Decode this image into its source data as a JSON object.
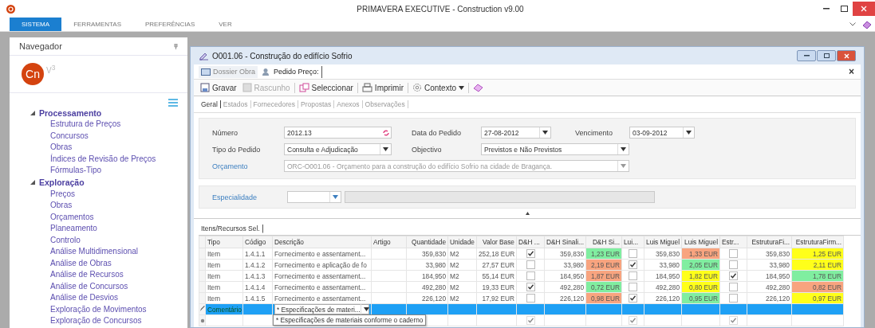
{
  "window": {
    "title": "PRIMAVERA EXECUTIVE - Construction v9.00"
  },
  "ribbon_tabs": [
    {
      "label": "SISTEMA",
      "selected": true
    },
    {
      "label": "FERRAMENTAS",
      "selected": false
    },
    {
      "label": "PREFERÊNCIAS",
      "selected": false
    },
    {
      "label": "VER",
      "selected": false
    }
  ],
  "navigator": {
    "title": "Navegador",
    "logo": "Cn",
    "version": "V$^{3}$",
    "tree": [
      {
        "label": "Processamento",
        "expanded": true,
        "children": [
          {
            "label": "Estrutura de Preços"
          },
          {
            "label": "Concursos"
          },
          {
            "label": "Obras"
          },
          {
            "label": "Índices de Revisão de Preços"
          },
          {
            "label": "Fórmulas-Tipo"
          }
        ]
      },
      {
        "label": "Exploração",
        "expanded": true,
        "children": [
          {
            "label": "Preços"
          },
          {
            "label": "Obras"
          },
          {
            "label": "Orçamentos"
          },
          {
            "label": "Planeamento"
          },
          {
            "label": "Controlo"
          },
          {
            "label": "Análise Multidimensional"
          },
          {
            "label": "Análise de Obras"
          },
          {
            "label": "Análise de Recursos"
          },
          {
            "label": "Análise de Concursos"
          },
          {
            "label": "Análise de Desvios"
          },
          {
            "label": "Exploração de Movimentos"
          },
          {
            "label": "Exploração de Concursos"
          }
        ]
      }
    ]
  },
  "document": {
    "title": "O001.06 - Construção do edifício Sofrio",
    "close": "×",
    "tabs": [
      {
        "label": "Dossier Obra",
        "selected": false
      },
      {
        "label": "Pedido Preço:",
        "selected": true
      }
    ],
    "toolbar": [
      {
        "kind": "save",
        "label": "Gravar",
        "disabled": false
      },
      {
        "kind": "draft",
        "label": "Rascunho",
        "disabled": true
      },
      {
        "kind": "select",
        "label": "Seleccionar",
        "disabled": false
      },
      {
        "kind": "print",
        "label": "Imprimir",
        "disabled": false
      },
      {
        "kind": "menu",
        "label": "Contexto",
        "disabled": false
      },
      {
        "kind": "eraser"
      }
    ],
    "subtabs": [
      {
        "label": "Geral",
        "selected": true
      },
      {
        "label": "Estados",
        "selected": false
      },
      {
        "label": "Fornecedores",
        "selected": false
      },
      {
        "label": "Propostas",
        "selected": false
      },
      {
        "label": "Anexos",
        "selected": false
      },
      {
        "label": "Observações",
        "selected": false
      }
    ],
    "form": {
      "numero": {
        "label": "Número",
        "value": "2012.13"
      },
      "data_pedido": {
        "label": "Data do Pedido",
        "value": "27-08-2012"
      },
      "vencimento": {
        "label": "Vencimento",
        "value": "03-09-2012"
      },
      "tipo_pedido": {
        "label": "Tipo do Pedido",
        "value": "Consulta e Adjudicação"
      },
      "objectivo": {
        "label": "Objectivo",
        "value": "Previstos e Não Previstos"
      },
      "orcamento": {
        "label": "Orçamento",
        "value": "ORC-O001.06 - Orçamento para a construção do edifício Sofrio na cidade de Bragança.",
        "disabled": true
      },
      "especialidade": {
        "label": "Especialidade"
      }
    },
    "grid": {
      "tab": "Itens/Recursos Sel.",
      "columns": [
        {
          "label": "Tipo",
          "kind": "text"
        },
        {
          "label": "Código",
          "kind": "text"
        },
        {
          "label": "Descrição",
          "kind": "text"
        },
        {
          "label": "Artigo",
          "kind": "text"
        },
        {
          "label": "Quantidade",
          "kind": "number"
        },
        {
          "label": "Unidade",
          "kind": "text"
        },
        {
          "label": "Valor Base",
          "kind": "number"
        },
        {
          "label": "D&H ...",
          "kind": "check"
        },
        {
          "label": "D&H Sinali...",
          "kind": "number"
        },
        {
          "label": "D&H Si...",
          "kind": "price"
        },
        {
          "label": "Lui...",
          "kind": "check"
        },
        {
          "label": "Luis Miguel",
          "kind": "number"
        },
        {
          "label": "Luis Miguel",
          "kind": "price"
        },
        {
          "label": "Estr...",
          "kind": "check"
        },
        {
          "label": "EstruturaFi...",
          "kind": "number"
        },
        {
          "label": "EstruturaFirm...",
          "kind": "price"
        }
      ],
      "rows": [
        {
          "kind": "item",
          "selected": false,
          "cells": [
            "Item",
            "1.4.1.1",
            "Fornecimento e assentament...",
            null,
            "359,830",
            "M2",
            "252,18 EUR",
            {
              "checked": true,
              "disabled": false
            },
            "359,830",
            {
              "text": "1,23 EUR",
              "color": "#80eea0"
            },
            {
              "checked": false,
              "disabled": false
            },
            "359,830",
            {
              "text": "1,33 EUR",
              "color": "#f8a47f"
            },
            {
              "checked": false,
              "disabled": false
            },
            "359,830",
            {
              "text": "1,25 EUR",
              "color": "#ffff1a"
            }
          ]
        },
        {
          "kind": "item",
          "selected": false,
          "cells": [
            "Item",
            "1.4.1.2",
            "Fornecimento e aplicação de fo",
            null,
            "33,980",
            "M2",
            "27,57 EUR",
            {
              "checked": false,
              "disabled": false
            },
            "33,980",
            {
              "text": "2,19 EUR",
              "color": "#f8a47f"
            },
            {
              "checked": true,
              "disabled": false
            },
            "33,980",
            {
              "text": "2,05 EUR",
              "color": "#80eea0"
            },
            {
              "checked": false,
              "disabled": false
            },
            "33,980",
            {
              "text": "2,11 EUR",
              "color": "#ffff1a"
            }
          ]
        },
        {
          "kind": "item",
          "selected": false,
          "cells": [
            "Item",
            "1.4.1.3",
            "Fornecimento e assentament...",
            null,
            "184,950",
            "M2",
            "55,14 EUR",
            {
              "checked": false,
              "disabled": false
            },
            "184,950",
            {
              "text": "1,87 EUR",
              "color": "#f8a47f"
            },
            {
              "checked": false,
              "disabled": false
            },
            "184,950",
            {
              "text": "1,82 EUR",
              "color": "#ffff1a"
            },
            {
              "checked": true,
              "disabled": false
            },
            "184,950",
            {
              "text": "1,78 EUR",
              "color": "#80eea0"
            }
          ]
        },
        {
          "kind": "item",
          "selected": false,
          "cells": [
            "Item",
            "1.4.1.4",
            "Fornecimento e assentament...",
            null,
            "492,280",
            "M2",
            "19,33 EUR",
            {
              "checked": true,
              "disabled": false
            },
            "492,280",
            {
              "text": "0,72 EUR",
              "color": "#80eea0"
            },
            {
              "checked": false,
              "disabled": false
            },
            "492,280",
            {
              "text": "0,80 EUR",
              "color": "#ffff1a"
            },
            {
              "checked": false,
              "disabled": false
            },
            "492,280",
            {
              "text": "0,82 EUR",
              "color": "#f8a47f"
            }
          ]
        },
        {
          "kind": "item",
          "selected": false,
          "cells": [
            "Item",
            "1.4.1.5",
            "Fornecimento e assentament...",
            null,
            "226,120",
            "M2",
            "17,92 EUR",
            {
              "checked": false,
              "disabled": false
            },
            "226,120",
            {
              "text": "0,98 EUR",
              "color": "#f8a47f"
            },
            {
              "checked": true,
              "disabled": false
            },
            "226,120",
            {
              "text": "0,95 EUR",
              "color": "#80eea0"
            },
            {
              "checked": false,
              "disabled": false
            },
            "226,120",
            {
              "text": "0,97 EUR",
              "color": "#ffff1a"
            }
          ]
        },
        {
          "kind": "comment",
          "selected": true,
          "tipo": "Comentário",
          "descricao": "* Especificações de materi...",
          "options": [
            "* Especificações de materiais conforme o caderno"
          ]
        },
        {
          "kind": "new",
          "selected": false,
          "cells": [
            null,
            null,
            null,
            null,
            null,
            null,
            null,
            {
              "checked": true,
              "disabled": true
            },
            null,
            null,
            {
              "checked": true,
              "disabled": true
            },
            null,
            null,
            {
              "checked": true,
              "disabled": true
            },
            null,
            null
          ]
        }
      ]
    }
  }
}
